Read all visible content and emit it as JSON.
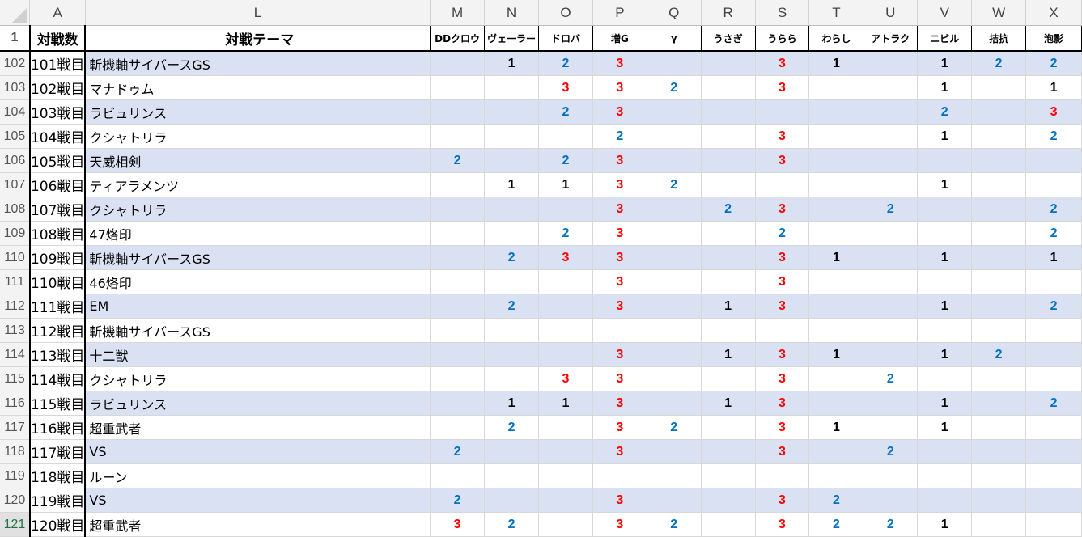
{
  "colors": {
    "v1": "#000000",
    "v2": "#0070c0",
    "v3": "#ff0000",
    "band": "#d9e1f2"
  },
  "column_letters": [
    "A",
    "L",
    "M",
    "N",
    "O",
    "P",
    "Q",
    "R",
    "S",
    "T",
    "U",
    "V",
    "W",
    "X"
  ],
  "header_row_number": "1",
  "header": {
    "a": "対戦数",
    "l": "対戦テーマ",
    "matchups": [
      "DDクロウ",
      "ヴェーラー",
      "ドロバ",
      "増G",
      "γ",
      "うさぎ",
      "うらら",
      "わらし",
      "アトラク",
      "ニビル",
      "拮抗",
      "泡影"
    ]
  },
  "rows": [
    {
      "num": "102",
      "a": "101戦目",
      "l": "斬機軸サイバースGS",
      "v": [
        "",
        "1",
        "2",
        "3",
        "",
        "",
        "3",
        "1",
        "",
        "1",
        "2",
        "2"
      ]
    },
    {
      "num": "103",
      "a": "102戦目",
      "l": "マナドゥム",
      "v": [
        "",
        "",
        "3",
        "3",
        "2",
        "",
        "3",
        "",
        "",
        "1",
        "",
        "1"
      ]
    },
    {
      "num": "104",
      "a": "103戦目",
      "l": "ラビュリンス",
      "v": [
        "",
        "",
        "2",
        "3",
        "",
        "",
        "",
        "",
        "",
        "2",
        "",
        "3"
      ]
    },
    {
      "num": "105",
      "a": "104戦目",
      "l": "クシャトリラ",
      "v": [
        "",
        "",
        "",
        "2",
        "",
        "",
        "3",
        "",
        "",
        "1",
        "",
        "2"
      ]
    },
    {
      "num": "106",
      "a": "105戦目",
      "l": "天威相剣",
      "v": [
        "2",
        "",
        "2",
        "3",
        "",
        "",
        "3",
        "",
        "",
        "",
        "",
        ""
      ]
    },
    {
      "num": "107",
      "a": "106戦目",
      "l": "ティアラメンツ",
      "v": [
        "",
        "1",
        "1",
        "3",
        "2",
        "",
        "",
        "",
        "",
        "1",
        "",
        ""
      ]
    },
    {
      "num": "108",
      "a": "107戦目",
      "l": "クシャトリラ",
      "v": [
        "",
        "",
        "",
        "3",
        "",
        "2",
        "3",
        "",
        "2",
        "",
        "",
        "2"
      ]
    },
    {
      "num": "109",
      "a": "108戦目",
      "l": "47烙印",
      "v": [
        "",
        "",
        "2",
        "3",
        "",
        "",
        "2",
        "",
        "",
        "",
        "",
        "2"
      ]
    },
    {
      "num": "110",
      "a": "109戦目",
      "l": "斬機軸サイバースGS",
      "v": [
        "",
        "2",
        "3",
        "3",
        "",
        "",
        "3",
        "1",
        "",
        "1",
        "",
        "1"
      ]
    },
    {
      "num": "111",
      "a": "110戦目",
      "l": "46烙印",
      "v": [
        "",
        "",
        "",
        "3",
        "",
        "",
        "3",
        "",
        "",
        "",
        "",
        ""
      ]
    },
    {
      "num": "112",
      "a": "111戦目",
      "l": "EM",
      "v": [
        "",
        "2",
        "",
        "3",
        "",
        "1",
        "3",
        "",
        "",
        "1",
        "",
        "2"
      ]
    },
    {
      "num": "113",
      "a": "112戦目",
      "l": "斬機軸サイバースGS",
      "v": [
        "",
        "",
        "",
        "",
        "",
        "",
        "",
        "",
        "",
        "",
        "",
        ""
      ]
    },
    {
      "num": "114",
      "a": "113戦目",
      "l": "十二獣",
      "v": [
        "",
        "",
        "",
        "3",
        "",
        "1",
        "3",
        "1",
        "",
        "1",
        "2",
        ""
      ]
    },
    {
      "num": "115",
      "a": "114戦目",
      "l": "クシャトリラ",
      "v": [
        "",
        "",
        "3",
        "3",
        "",
        "",
        "3",
        "",
        "2",
        "",
        "",
        ""
      ]
    },
    {
      "num": "116",
      "a": "115戦目",
      "l": "ラビュリンス",
      "v": [
        "",
        "1",
        "1",
        "3",
        "",
        "1",
        "3",
        "",
        "",
        "1",
        "",
        "2"
      ]
    },
    {
      "num": "117",
      "a": "116戦目",
      "l": "超重武者",
      "v": [
        "",
        "2",
        "",
        "3",
        "2",
        "",
        "3",
        "1",
        "",
        "1",
        "",
        ""
      ]
    },
    {
      "num": "118",
      "a": "117戦目",
      "l": "VS",
      "v": [
        "2",
        "",
        "",
        "3",
        "",
        "",
        "3",
        "",
        "2",
        "",
        "",
        ""
      ]
    },
    {
      "num": "119",
      "a": "118戦目",
      "l": "ルーン",
      "v": [
        "",
        "",
        "",
        "",
        "",
        "",
        "",
        "",
        "",
        "",
        "",
        ""
      ]
    },
    {
      "num": "120",
      "a": "119戦目",
      "l": "VS",
      "v": [
        "2",
        "",
        "",
        "3",
        "",
        "",
        "3",
        "2",
        "",
        "",
        "",
        ""
      ]
    },
    {
      "num": "121",
      "a": "120戦目",
      "l": "超重武者",
      "v": [
        "3",
        "2",
        "",
        "3",
        "2",
        "",
        "3",
        "2",
        "2",
        "1",
        "",
        ""
      ]
    }
  ]
}
